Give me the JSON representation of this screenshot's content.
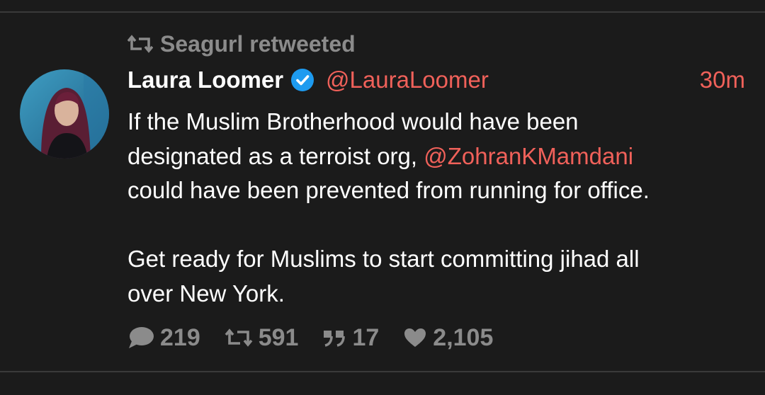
{
  "retweet": {
    "icon": "retweet-icon",
    "text": "Seagurl retweeted"
  },
  "tweet": {
    "author": {
      "display_name": "Laura Loomer",
      "handle": "@LauraLoomer",
      "verified": true,
      "avatar_icon": "avatar"
    },
    "time": "30m",
    "body": {
      "line1": "If the Muslim Brotherhood would have been",
      "line2_pre": "designated as a terroist org, ",
      "mention": "@ZohranKMamdani",
      "line3": "could have been prevented from running for office.",
      "line4": "Get ready for Muslims to start committing jihad all",
      "line5": "over New York."
    },
    "stats": {
      "replies": "219",
      "retweets": "591",
      "quotes": "17",
      "likes": "2,105"
    }
  },
  "colors": {
    "background": "#1b1b1b",
    "accent": "#f0615a",
    "muted": "#8b8b8b",
    "text": "#ffffff",
    "verified": "#1d9bf0"
  }
}
